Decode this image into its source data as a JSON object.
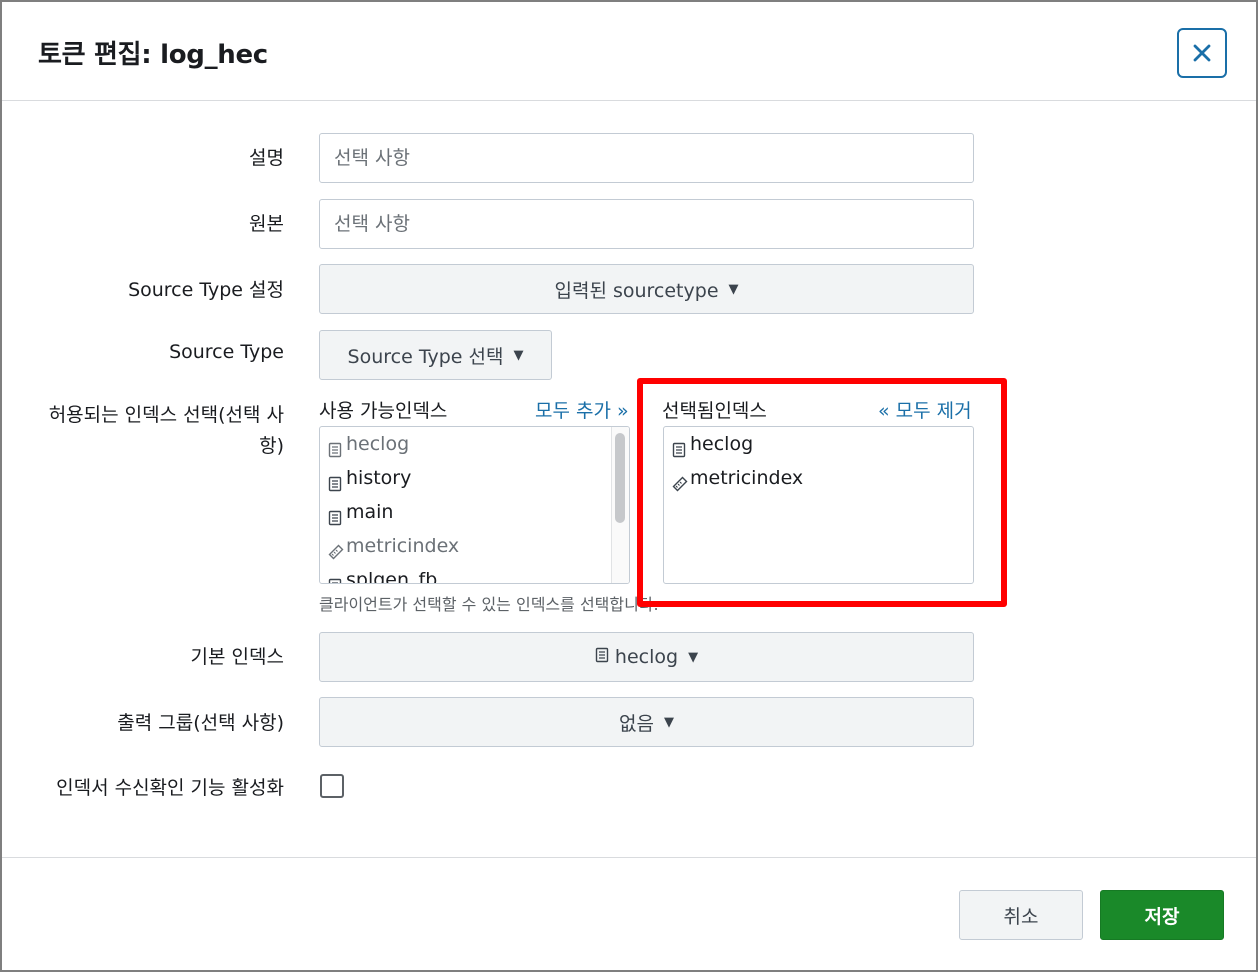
{
  "dialog": {
    "title": "토큰 편집: log_hec",
    "close_icon": "close-icon"
  },
  "form": {
    "description": {
      "label": "설명",
      "placeholder": "선택 사항"
    },
    "source": {
      "label": "원본",
      "placeholder": "선택 사항"
    },
    "source_type_setting": {
      "label": "Source Type 설정",
      "value": "입력된 sourcetype"
    },
    "source_type": {
      "label": "Source Type",
      "value": "Source Type 선택"
    },
    "allowed_indexes": {
      "label": "허용되는 인덱스 선택(선택 사항)",
      "available": {
        "header": "사용 가능인덱스",
        "add_all": "모두 추가 »",
        "items": [
          {
            "name": "heclog",
            "icon": "event-index-icon",
            "dim": true
          },
          {
            "name": "history",
            "icon": "event-index-icon",
            "dim": false
          },
          {
            "name": "main",
            "icon": "event-index-icon",
            "dim": false
          },
          {
            "name": "metricindex",
            "icon": "metric-index-icon",
            "dim": true
          },
          {
            "name": "splgen_fb",
            "icon": "event-index-icon",
            "dim": false
          }
        ]
      },
      "selected": {
        "header": "선택됨인덱스",
        "remove_all": "« 모두 제거",
        "items": [
          {
            "name": "heclog",
            "icon": "event-index-icon"
          },
          {
            "name": "metricindex",
            "icon": "metric-index-icon"
          }
        ]
      },
      "help": "클라이언트가 선택할 수 있는 인덱스를 선택합니다."
    },
    "default_index": {
      "label": "기본 인덱스",
      "value": "heclog",
      "icon": "event-index-icon"
    },
    "output_group": {
      "label": "출력 그룹(선택 사항)",
      "value": "없음"
    },
    "indexer_ack": {
      "label": "인덱서 수신확인 기능 활성화",
      "checked": false
    }
  },
  "footer": {
    "cancel_label": "취소",
    "save_label": "저장"
  },
  "colors": {
    "link": "#1a6fa8",
    "save_button": "#1a8929",
    "highlight": "#ff0000"
  }
}
